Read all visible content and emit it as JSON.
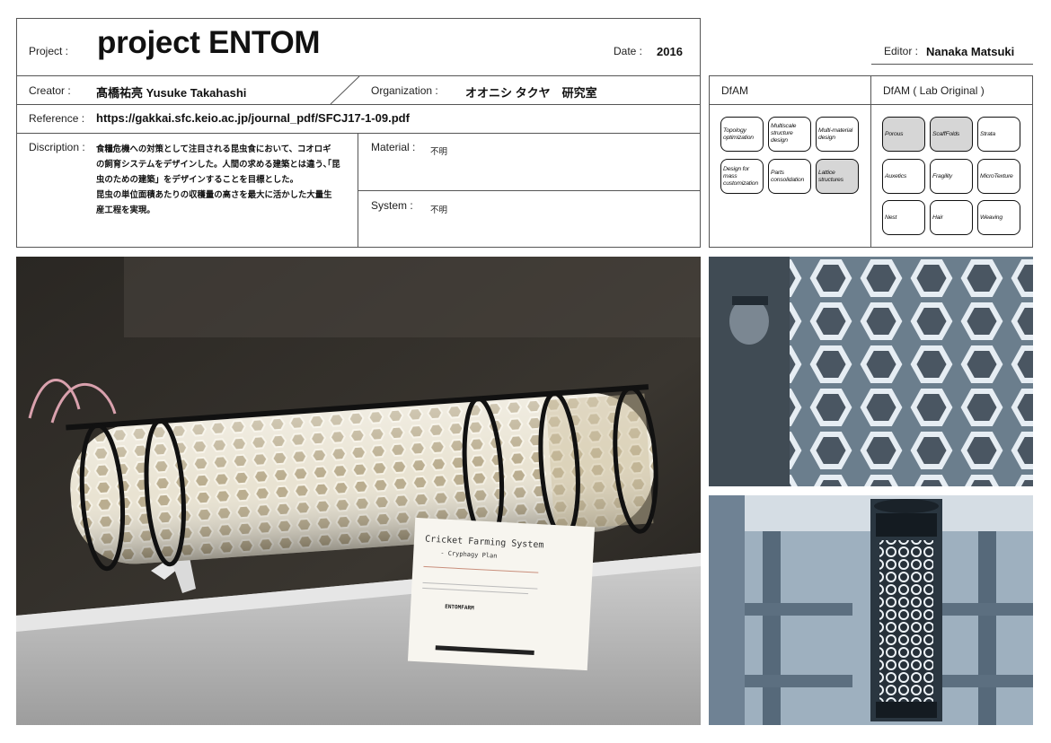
{
  "header": {
    "project_label": "Project :",
    "project_title": "project ENTOM",
    "date_label": "Date :",
    "date_value": "2016",
    "editor_label": "Editor :",
    "editor_value": "Nanaka Matsuki"
  },
  "info": {
    "creator_label": "Creator :",
    "creator_value": "髙橋祐亮 Yusuke Takahashi",
    "organization_label": "Organization :",
    "organization_value": "オオニシ タクヤ　研究室",
    "reference_label": "Reference :",
    "reference_value": "https://gakkai.sfc.keio.ac.jp/journal_pdf/SFCJ17-1-09.pdf",
    "description_label": "Discription :",
    "description_lines": [
      "食糧危機への対策として注目される昆虫食において、コオロギ",
      "の飼育システムをデザインした。人間の求める建築とは違う､｢昆",
      "虫のための建築」をデザインすることを目標とした。",
      "昆虫の単位面積あたりの収穫量の高さを最大に活かした大量生",
      "産工程を実現。"
    ],
    "material_label": "Material :",
    "material_value": "不明",
    "system_label": "System :",
    "system_value": "不明"
  },
  "dfam": {
    "heading": "DfAM",
    "items": [
      {
        "label": "Topology optimization",
        "selected": false
      },
      {
        "label": "Multiscale structure design",
        "selected": false
      },
      {
        "label": "Multi-material design",
        "selected": false
      },
      {
        "label": "Design for mass customization",
        "selected": false
      },
      {
        "label": "Parts consolidation",
        "selected": false
      },
      {
        "label": "Lattice structures",
        "selected": true
      }
    ]
  },
  "dfam_lab": {
    "heading": "DfAM ( Lab Original )",
    "items": [
      {
        "label": "Porous",
        "selected": true
      },
      {
        "label": "ScaffFolds",
        "selected": true
      },
      {
        "label": "Strata",
        "selected": false
      },
      {
        "label": "Auxetics",
        "selected": false
      },
      {
        "label": "Fragility",
        "selected": false
      },
      {
        "label": "MicroTexture",
        "selected": false
      },
      {
        "label": "Nest",
        "selected": false
      },
      {
        "label": "Hair",
        "selected": false
      },
      {
        "label": "Weaving",
        "selected": false
      }
    ]
  },
  "photos": {
    "main_card_title": "Cricket Farming System",
    "main_card_subtitle": "- Cryphagy Plan",
    "main_card_logo": "ENTOMFARM"
  },
  "colors": {
    "border": "#555555",
    "chip_selected": "#d6d6d6",
    "photo_tint": "#9fb3c4"
  }
}
